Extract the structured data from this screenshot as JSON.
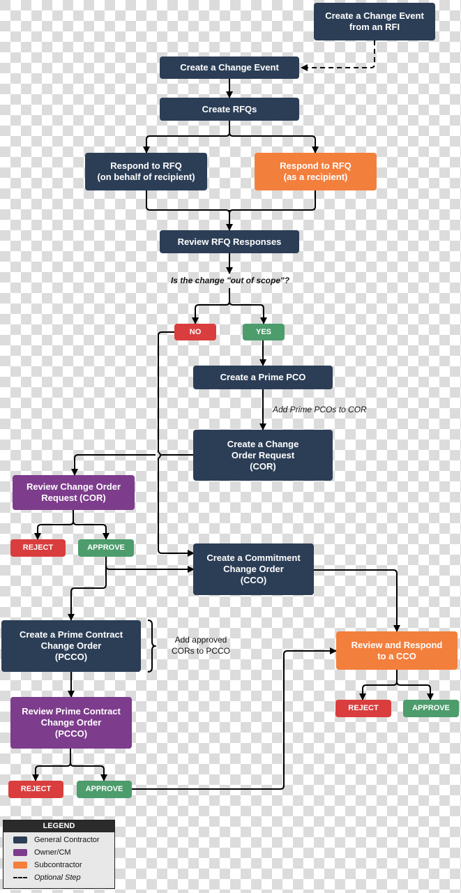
{
  "colors": {
    "general_contractor": "#2c3e56",
    "owner_cm": "#7d3c8c",
    "subcontractor": "#f37f3d",
    "reject": "#da3d3d",
    "approve": "#4c9c6c"
  },
  "nodes": {
    "change_event_from_rfi": "Create a Change Event\nfrom an RFI",
    "create_change_event": "Create a Change Event",
    "create_rfqs": "Create RFQs",
    "respond_rfq_behalf": "Respond to RFQ\n(on behalf of recipient)",
    "respond_rfq_recipient": "Respond to RFQ\n(as a recipient)",
    "review_rfq_responses": "Review RFQ Responses",
    "decision_question": "Is the change \"out of scope\"?",
    "no": "NO",
    "yes": "YES",
    "create_prime_pco": "Create a Prime PCO",
    "add_prime_pcos_note": "Add Prime PCOs to COR",
    "create_cor": "Create a Change\nOrder Request\n(COR)",
    "review_cor": "Review Change Order\nRequest (COR)",
    "cor_reject": "REJECT",
    "cor_approve": "APPROVE",
    "create_cco": "Create a Commitment\nChange Order\n(CCO)",
    "create_pcco": "Create a Prime Contract\nChange Order\n(PCCO)",
    "add_cors_note": "Add approved\nCORs to PCCO",
    "review_cco": "Review and Respond\nto a CCO",
    "cco_reject": "REJECT",
    "cco_approve": "APPROVE",
    "review_pcco": "Review Prime Contract\nChange Order\n(PCCO)",
    "pcco_reject": "REJECT",
    "pcco_approve": "APPROVE"
  },
  "legend": {
    "title": "LEGEND",
    "items": [
      {
        "label": "General Contractor",
        "type": "swatch",
        "color": "#2c3e56"
      },
      {
        "label": "Owner/CM",
        "type": "swatch",
        "color": "#7d3c8c"
      },
      {
        "label": "Subcontractor",
        "type": "swatch",
        "color": "#f37f3d"
      },
      {
        "label": "Optional Step",
        "type": "dash"
      }
    ]
  }
}
